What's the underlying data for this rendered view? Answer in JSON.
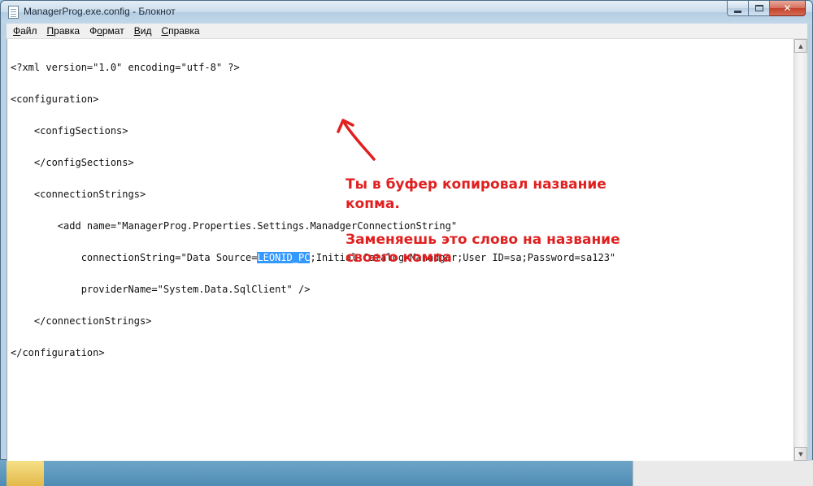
{
  "window": {
    "title": "ManagerProg.exe.config - Блокнот",
    "controls": {
      "minimize": "minimize",
      "maximize": "maximize",
      "close": "✕"
    }
  },
  "menu": [
    {
      "label": "Файл",
      "mnemonic": "Ф",
      "rest": "айл"
    },
    {
      "label": "Правка",
      "mnemonic": "П",
      "rest": "равка"
    },
    {
      "label": "Формат",
      "mnemonic": "о",
      "pre": "Ф",
      "rest": "рмат"
    },
    {
      "label": "Вид",
      "mnemonic": "В",
      "rest": "ид"
    },
    {
      "label": "Справка",
      "mnemonic": "С",
      "rest": "правка"
    }
  ],
  "document": {
    "lines": [
      "<?xml version=\"1.0\" encoding=\"utf-8\" ?>",
      "<configuration>",
      "    <configSections>",
      "    </configSections>",
      "    <connectionStrings>",
      "        <add name=\"ManagerProg.Properties.Settings.ManadgerConnectionString\"",
      "            connectionString=\"Data Source=",
      "            providerName=\"System.Data.SqlClient\" />",
      "    </connectionStrings>",
      "</configuration>"
    ],
    "selected_text": "LEONID_PC",
    "after_selection": ";Initial Catalog=Manadger;User ID=sa;Password=sa123\""
  },
  "annotation": {
    "line1": "Ты в буфер копировал название",
    "line2": "копма.",
    "line3": "Заменяешь это слово на название",
    "line4": "своего компа",
    "color": "#e02020"
  }
}
